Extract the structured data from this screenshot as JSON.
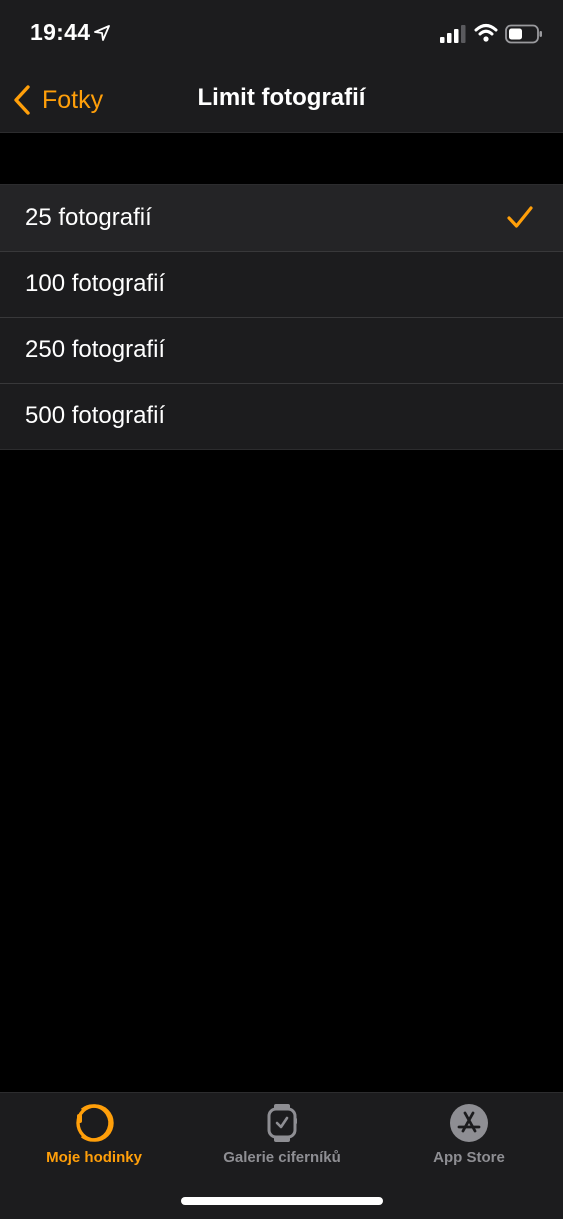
{
  "status_bar": {
    "time": "19:44"
  },
  "nav": {
    "back_label": "Fotky",
    "title": "Limit fotografií"
  },
  "options": [
    {
      "label": "25 fotografií",
      "selected": true
    },
    {
      "label": "100 fotografií",
      "selected": false
    },
    {
      "label": "250 fotografií",
      "selected": false
    },
    {
      "label": "500 fotografií",
      "selected": false
    }
  ],
  "tabs": [
    {
      "label": "Moje hodinky",
      "icon": "watch-icon",
      "active": true
    },
    {
      "label": "Galerie ciferníků",
      "icon": "watch-face-icon",
      "active": false
    },
    {
      "label": "App Store",
      "icon": "app-store-icon",
      "active": false
    }
  ],
  "colors": {
    "accent": "#ff9f0a",
    "background": "#000000",
    "surface": "#1c1c1e",
    "inactive": "#8e8e93"
  }
}
